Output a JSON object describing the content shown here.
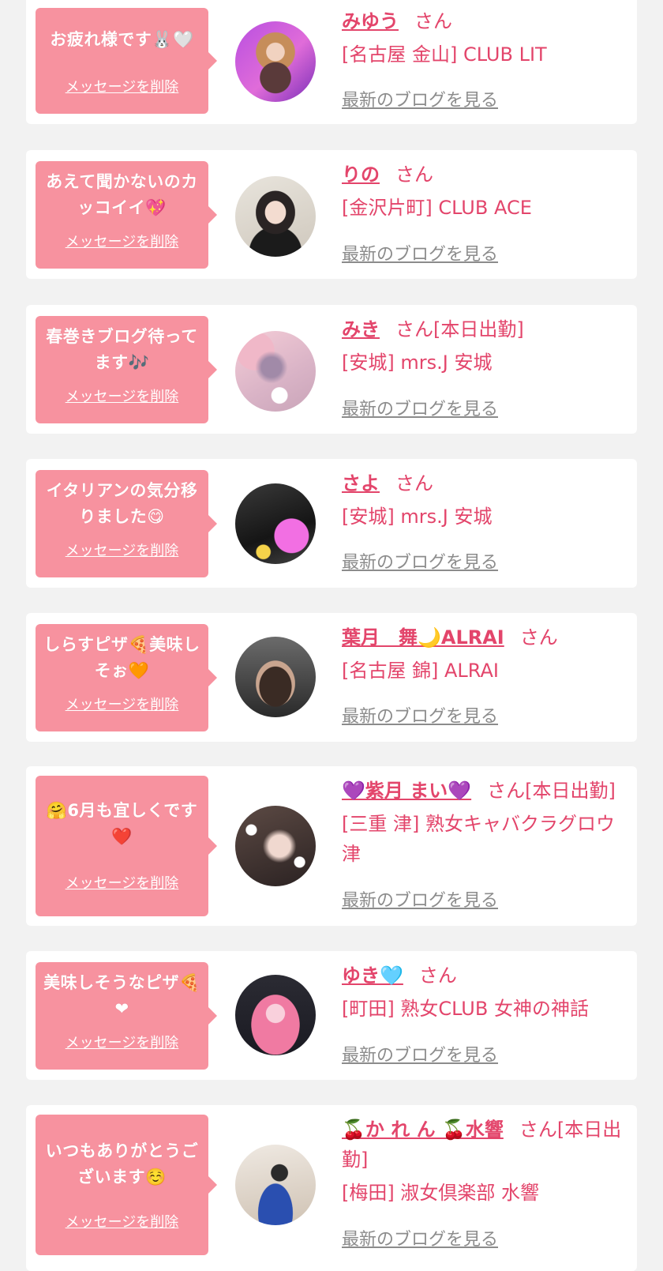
{
  "delete_label": "メッセージを削除",
  "blog_label": "最新のブログを見る",
  "honorific": "さん",
  "colors": {
    "accent": "#e3456b",
    "bubble": "#f7929f",
    "background": "#f2f2f2",
    "link_gray": "#8c8c8c"
  },
  "items": [
    {
      "message": "お疲れ様です",
      "message_emoji": "🐰🤍",
      "name": "みゆう",
      "name_suffix": "",
      "shop": "[名古屋 金山] CLUB LIT"
    },
    {
      "message": "あえて聞かないのカッコイイ",
      "message_emoji": "💖",
      "name": "りの",
      "name_suffix": "",
      "shop": "[金沢片町] CLUB ACE"
    },
    {
      "message": "春巻きブログ待ってます",
      "message_emoji": "🎶",
      "name": "みき",
      "name_suffix": "[本日出勤]",
      "shop": "[安城] mrs.J 安城"
    },
    {
      "message": "イタリアンの気分移りました",
      "message_emoji": "😋",
      "name": "さよ",
      "name_suffix": "",
      "shop": "[安城] mrs.J 安城"
    },
    {
      "message": "しらすピザ🍕美味しそぉ",
      "message_emoji": "🧡",
      "name": "葉月　舞🌙ALRAI",
      "name_suffix": "",
      "shop": "[名古屋 錦] ALRAI"
    },
    {
      "message": "🤗6月も宜しくです",
      "message_emoji": "❤️",
      "name": "💜紫月 まい💜",
      "name_suffix": "[本日出勤]",
      "shop": "[三重 津] 熟女キャバクラグロウ津"
    },
    {
      "message": "美味しそうなピザ",
      "message_emoji": "🍕❤",
      "name": "ゆき🩵",
      "name_suffix": "",
      "shop": "[町田] 熟女CLUB 女神の神話"
    },
    {
      "message": "いつもありがとうございます",
      "message_emoji": "☺️",
      "name": "🍒か れ ん 🍒水響",
      "name_suffix": "[本日出勤]",
      "shop": "[梅田] 淑女倶楽部 水響"
    }
  ]
}
